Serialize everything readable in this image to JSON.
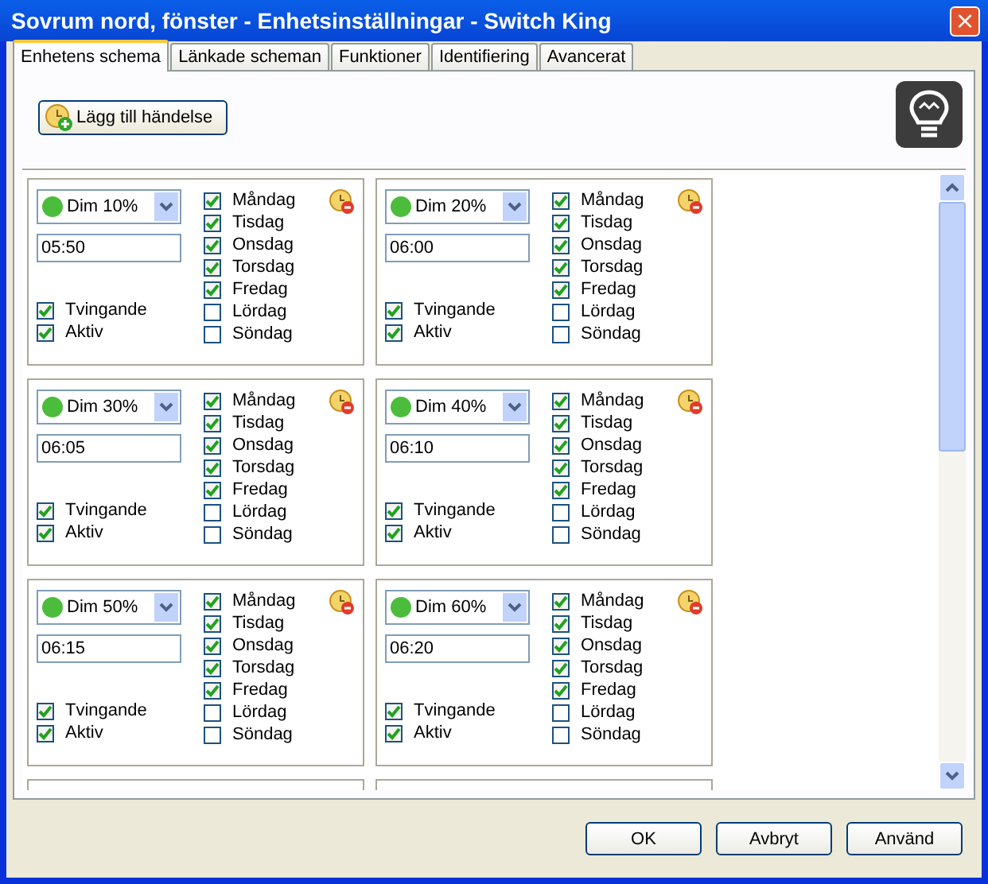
{
  "window": {
    "title": "Sovrum nord, fönster - Enhetsinställningar - Switch King",
    "close": "×"
  },
  "tabs": [
    {
      "label": "Enhetens schema",
      "selected": true
    },
    {
      "label": "Länkade scheman",
      "selected": false
    },
    {
      "label": "Funktioner",
      "selected": false
    },
    {
      "label": "Identifiering",
      "selected": false
    },
    {
      "label": "Avancerat",
      "selected": false
    }
  ],
  "add_button": "Lägg till händelse",
  "events": [
    {
      "action": "Dim 10%",
      "time": "05:50",
      "options": [
        {
          "label": "Tvingande",
          "checked": true
        },
        {
          "label": "Aktiv",
          "checked": true
        }
      ],
      "days": [
        {
          "label": "Måndag",
          "checked": true
        },
        {
          "label": "Tisdag",
          "checked": true
        },
        {
          "label": "Onsdag",
          "checked": true
        },
        {
          "label": "Torsdag",
          "checked": true
        },
        {
          "label": "Fredag",
          "checked": true
        },
        {
          "label": "Lördag",
          "checked": false
        },
        {
          "label": "Söndag",
          "checked": false
        }
      ]
    },
    {
      "action": "Dim 20%",
      "time": "06:00",
      "options": [
        {
          "label": "Tvingande",
          "checked": true
        },
        {
          "label": "Aktiv",
          "checked": true
        }
      ],
      "days": [
        {
          "label": "Måndag",
          "checked": true
        },
        {
          "label": "Tisdag",
          "checked": true
        },
        {
          "label": "Onsdag",
          "checked": true
        },
        {
          "label": "Torsdag",
          "checked": true
        },
        {
          "label": "Fredag",
          "checked": true
        },
        {
          "label": "Lördag",
          "checked": false
        },
        {
          "label": "Söndag",
          "checked": false
        }
      ]
    },
    {
      "action": "Dim 30%",
      "time": "06:05",
      "options": [
        {
          "label": "Tvingande",
          "checked": true
        },
        {
          "label": "Aktiv",
          "checked": true
        }
      ],
      "days": [
        {
          "label": "Måndag",
          "checked": true
        },
        {
          "label": "Tisdag",
          "checked": true
        },
        {
          "label": "Onsdag",
          "checked": true
        },
        {
          "label": "Torsdag",
          "checked": true
        },
        {
          "label": "Fredag",
          "checked": true
        },
        {
          "label": "Lördag",
          "checked": false
        },
        {
          "label": "Söndag",
          "checked": false
        }
      ]
    },
    {
      "action": "Dim 40%",
      "time": "06:10",
      "options": [
        {
          "label": "Tvingande",
          "checked": true
        },
        {
          "label": "Aktiv",
          "checked": true
        }
      ],
      "days": [
        {
          "label": "Måndag",
          "checked": true
        },
        {
          "label": "Tisdag",
          "checked": true
        },
        {
          "label": "Onsdag",
          "checked": true
        },
        {
          "label": "Torsdag",
          "checked": true
        },
        {
          "label": "Fredag",
          "checked": true
        },
        {
          "label": "Lördag",
          "checked": false
        },
        {
          "label": "Söndag",
          "checked": false
        }
      ]
    },
    {
      "action": "Dim 50%",
      "time": "06:15",
      "options": [
        {
          "label": "Tvingande",
          "checked": true
        },
        {
          "label": "Aktiv",
          "checked": true
        }
      ],
      "days": [
        {
          "label": "Måndag",
          "checked": true
        },
        {
          "label": "Tisdag",
          "checked": true
        },
        {
          "label": "Onsdag",
          "checked": true
        },
        {
          "label": "Torsdag",
          "checked": true
        },
        {
          "label": "Fredag",
          "checked": true
        },
        {
          "label": "Lördag",
          "checked": false
        },
        {
          "label": "Söndag",
          "checked": false
        }
      ]
    },
    {
      "action": "Dim 60%",
      "time": "06:20",
      "options": [
        {
          "label": "Tvingande",
          "checked": true
        },
        {
          "label": "Aktiv",
          "checked": true
        }
      ],
      "days": [
        {
          "label": "Måndag",
          "checked": true
        },
        {
          "label": "Tisdag",
          "checked": true
        },
        {
          "label": "Onsdag",
          "checked": true
        },
        {
          "label": "Torsdag",
          "checked": true
        },
        {
          "label": "Fredag",
          "checked": true
        },
        {
          "label": "Lördag",
          "checked": false
        },
        {
          "label": "Söndag",
          "checked": false
        }
      ]
    }
  ],
  "buttons": [
    "OK",
    "Avbryt",
    "Använd"
  ]
}
